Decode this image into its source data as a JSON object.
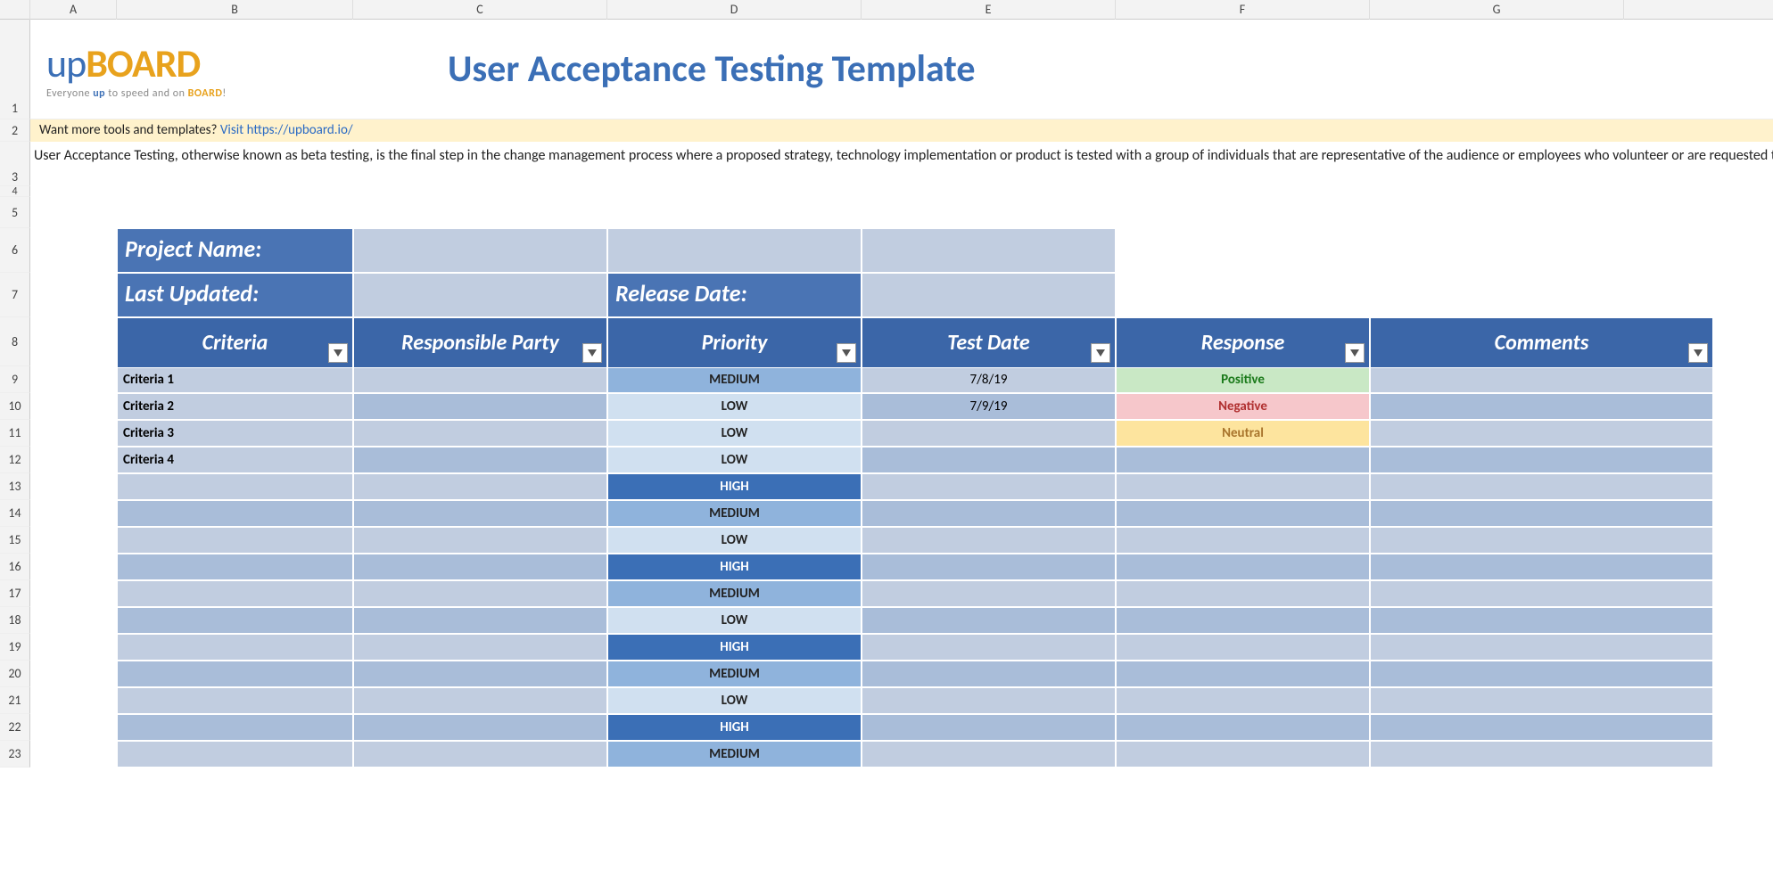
{
  "columns": [
    "",
    "A",
    "B",
    "C",
    "D",
    "E",
    "F",
    "G"
  ],
  "rows": [
    "1",
    "2",
    "3",
    "4",
    "5",
    "6",
    "7",
    "8",
    "9",
    "10",
    "11",
    "12",
    "13",
    "14",
    "15",
    "16",
    "17",
    "18",
    "19",
    "20",
    "21",
    "22",
    "23"
  ],
  "logo": {
    "up": "up",
    "board": "BOARD",
    "tagline_1": "Everyone ",
    "tagline_up": "up",
    "tagline_2": " to speed and on ",
    "tagline_board": "BOARD",
    "tagline_3": "!"
  },
  "title": "User Acceptance Testing Template",
  "banner": {
    "text": "Want more tools and templates? ",
    "link_text": "Visit https://upboard.io/"
  },
  "description": "User Acceptance Testing, otherwise known as beta testing, is the final step in the change management process where a proposed strategy, technology implementation or product is tested with a group of individuals that are representative of the audience or employees who volunteer or are requested to try out the new technology or service.",
  "form": {
    "project_name_label": "Project Name:",
    "project_name_value": "",
    "last_updated_label": "Last Updated:",
    "last_updated_value": "",
    "release_date_label": "Release Date:",
    "release_date_value": ""
  },
  "table_headers": {
    "criteria": "Criteria",
    "responsible": "Responsible Party",
    "priority": "Priority",
    "test_date": "Test Date",
    "response": "Response",
    "comments": "Comments"
  },
  "table_rows": [
    {
      "criteria": "Criteria 1",
      "responsible": "",
      "priority": "MEDIUM",
      "test_date": "7/8/19",
      "response": "Positive",
      "comments": ""
    },
    {
      "criteria": "Criteria 2",
      "responsible": "",
      "priority": "LOW",
      "test_date": "7/9/19",
      "response": "Negative",
      "comments": ""
    },
    {
      "criteria": "Criteria 3",
      "responsible": "",
      "priority": "LOW",
      "test_date": "",
      "response": "Neutral",
      "comments": ""
    },
    {
      "criteria": "Criteria 4",
      "responsible": "",
      "priority": "LOW",
      "test_date": "",
      "response": "",
      "comments": ""
    },
    {
      "criteria": "",
      "responsible": "",
      "priority": "HIGH",
      "test_date": "",
      "response": "",
      "comments": ""
    },
    {
      "criteria": "",
      "responsible": "",
      "priority": "MEDIUM",
      "test_date": "",
      "response": "",
      "comments": ""
    },
    {
      "criteria": "",
      "responsible": "",
      "priority": "LOW",
      "test_date": "",
      "response": "",
      "comments": ""
    },
    {
      "criteria": "",
      "responsible": "",
      "priority": "HIGH",
      "test_date": "",
      "response": "",
      "comments": ""
    },
    {
      "criteria": "",
      "responsible": "",
      "priority": "MEDIUM",
      "test_date": "",
      "response": "",
      "comments": ""
    },
    {
      "criteria": "",
      "responsible": "",
      "priority": "LOW",
      "test_date": "",
      "response": "",
      "comments": ""
    },
    {
      "criteria": "",
      "responsible": "",
      "priority": "HIGH",
      "test_date": "",
      "response": "",
      "comments": ""
    },
    {
      "criteria": "",
      "responsible": "",
      "priority": "MEDIUM",
      "test_date": "",
      "response": "",
      "comments": ""
    },
    {
      "criteria": "",
      "responsible": "",
      "priority": "LOW",
      "test_date": "",
      "response": "",
      "comments": ""
    },
    {
      "criteria": "",
      "responsible": "",
      "priority": "HIGH",
      "test_date": "",
      "response": "",
      "comments": ""
    },
    {
      "criteria": "",
      "responsible": "",
      "priority": "MEDIUM",
      "test_date": "",
      "response": "",
      "comments": ""
    }
  ],
  "priority_styles": {
    "LOW": "pri-low",
    "MEDIUM": "pri-med",
    "HIGH": "pri-high"
  },
  "response_styles": {
    "Positive": "resp-pos",
    "Negative": "resp-neg",
    "Neutral": "resp-neu"
  }
}
